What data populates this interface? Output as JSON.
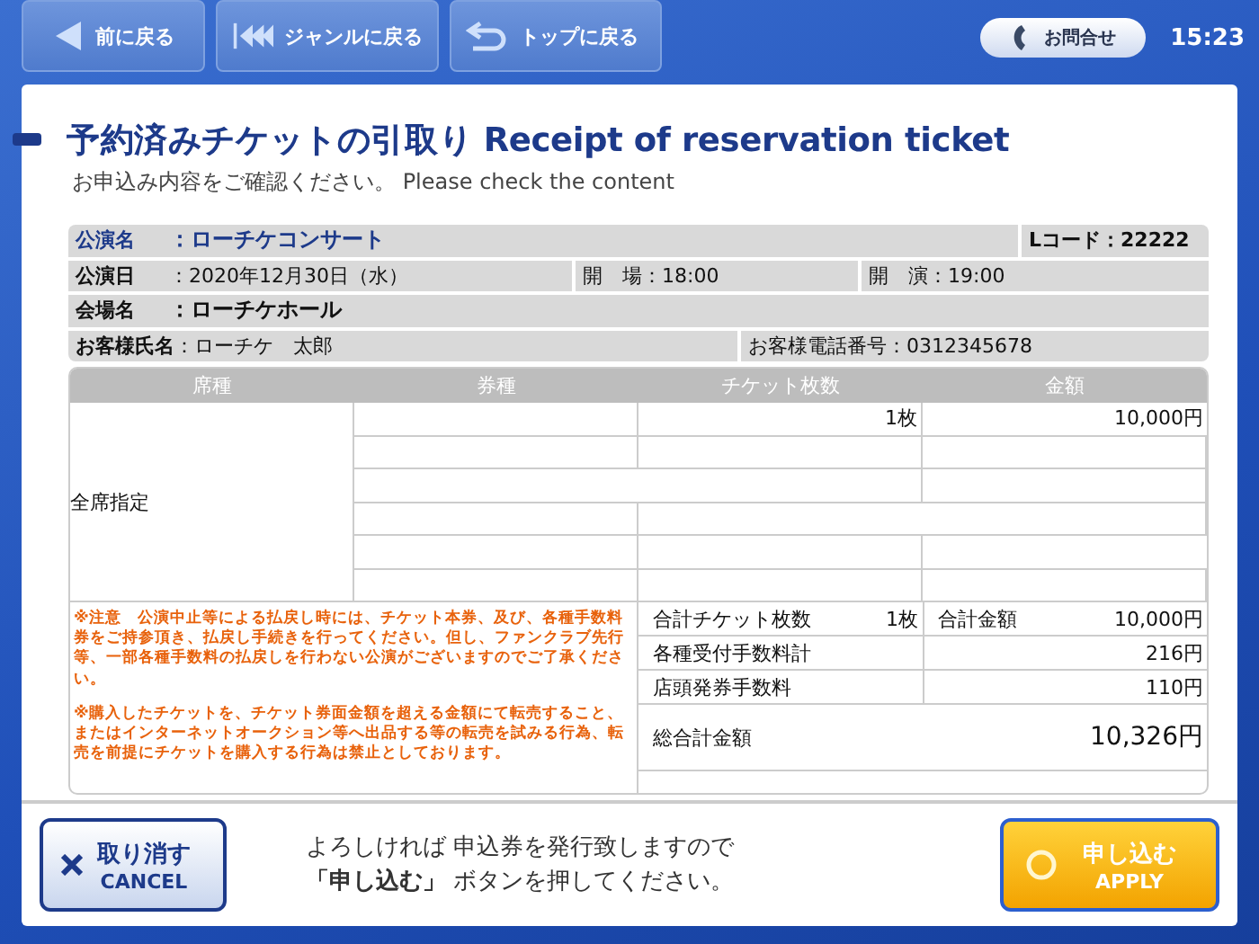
{
  "nav_buttons": [
    {
      "kind": "back",
      "label": "前に戻る"
    },
    {
      "kind": "genre",
      "label": "ジャンルに戻る"
    },
    {
      "kind": "top",
      "label": "トップに戻る"
    }
  ],
  "contact_button": {
    "label": "お問合せ"
  },
  "clock": "15:23",
  "title": "予約済みチケットの引取り Receipt of reservation ticket",
  "subtitle": "お申込み内容をご確認ください。 Please check the content",
  "info": {
    "performance": {
      "label": "公演名",
      "value": "：ローチケコンサート"
    },
    "l_code": "Lコード：22222",
    "date": {
      "label": "公演日",
      "value": "：2020年12月30日（水）"
    },
    "open": "開　場：18:00",
    "start": "開　演：19:00",
    "venue": {
      "label": "会場名",
      "value": "：ローチケホール"
    },
    "customer": {
      "label": "お客様氏名",
      "value": "：ローチケ　太郎"
    },
    "phone": "お客様電話番号：0312345678"
  },
  "table": {
    "columns": [
      "席種",
      "券種",
      "チケット枚数",
      "金額"
    ],
    "seat_type": "全席指定",
    "entries": [
      {
        "count": "1枚",
        "amount": "10,000円"
      }
    ]
  },
  "notes": [
    "※注意　公演中止等による払戻し時には、チケット本券、及び、各種手数料券をご持参頂き、払戻し手続きを行ってください。但し、ファンクラブ先行等、一部各種手数料の払戻しを行わない公演がございますのでご了承ください。",
    "※購入したチケットを、チケット券面金額を超える金額にて転売すること、またはインターネットオークション等へ出品する等の転売を試みる行為、転売を前提にチケットを購入する行為は禁止としております。"
  ],
  "summary": {
    "total_tickets": {
      "label": "合計チケット枚数",
      "value": "1枚"
    },
    "total_amount": {
      "label": "合計金額",
      "value": "10,000円"
    },
    "fees": [
      {
        "label": "各種受付手数料計",
        "value": "216円"
      },
      {
        "label": "店頭発券手数料",
        "value": "110円"
      }
    ],
    "grand_total": {
      "label": "総合計金額",
      "value": "10,326円"
    }
  },
  "cancel_button": {
    "label": "取り消す",
    "sublabel": "CANCEL"
  },
  "message": [
    "よろしければ 申込券を発行致しますので",
    "**「申し込む」** ボタンを押してください。"
  ],
  "apply_button": {
    "label": "申し込む",
    "sublabel": "APPLY"
  }
}
